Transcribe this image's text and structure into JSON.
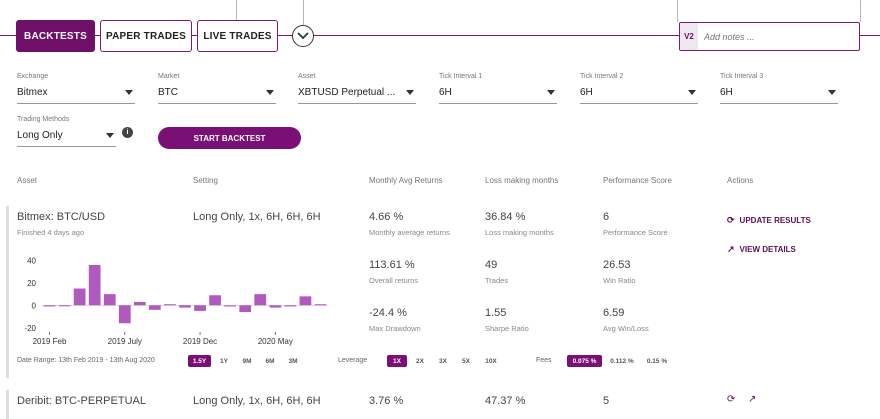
{
  "tabs": [
    {
      "label": "BACKTESTS",
      "active": true
    },
    {
      "label": "PAPER TRADES",
      "active": false
    },
    {
      "label": "LIVE TRADES",
      "active": false
    }
  ],
  "notes": {
    "version": "V2",
    "placeholder": "Add notes ..."
  },
  "form": {
    "exchange": {
      "label": "Exchange",
      "value": "Bitmex"
    },
    "market": {
      "label": "Market",
      "value": "BTC"
    },
    "asset": {
      "label": "Asset",
      "value": "XBTUSD Perpetual ..."
    },
    "tick1": {
      "label": "Tick Interval 1",
      "value": "6H"
    },
    "tick2": {
      "label": "Tick Interval 2",
      "value": "6H"
    },
    "tick3": {
      "label": "Tick Interval 3",
      "value": "6H"
    },
    "trading": {
      "label": "Trading Methods",
      "value": "Long Only"
    },
    "info_icon": "i",
    "start_label": "START BACKTEST"
  },
  "columns": [
    "Asset",
    "Setting",
    "Monthly Avg Returns",
    "Loss making months",
    "Performance Score",
    "Actions"
  ],
  "results": [
    {
      "asset": "Bitmex: BTC/USD",
      "finished": "Finished 4 days ago",
      "setting": "Long Only, 1x, 6H, 6H, 6H",
      "monthly_avg": "4.66 %",
      "monthly_avg_label": "Monthly average returns",
      "loss_months": "36.84 %",
      "loss_months_label": "Loss making months",
      "perf_score": "6",
      "perf_score_label": "Performance Score",
      "overall": "113.61 %",
      "overall_label": "Overall returns",
      "trades": "49",
      "trades_label": "Trades",
      "win_ratio": "26.53",
      "win_ratio_label": "Win Ratio",
      "max_dd": "-24.4 %",
      "max_dd_label": "Max Drawdown",
      "sharpe": "1.55",
      "sharpe_label": "Sharpe Ratio",
      "avg_wl": "6.59",
      "avg_wl_label": "Avg Win/Loss",
      "update_label": "UPDATE RESULTS",
      "details_label": "VIEW DETAILS",
      "date_range": "Date Range: 13th Feb 2019 - 13th Aug 2020",
      "ranges": [
        {
          "label": "1.5Y",
          "on": true
        },
        {
          "label": "1Y",
          "on": false
        },
        {
          "label": "9M",
          "on": false
        },
        {
          "label": "6M",
          "on": false
        },
        {
          "label": "3M",
          "on": false
        }
      ],
      "leverage_label": "Leverage",
      "leverages": [
        {
          "label": "1X",
          "on": true
        },
        {
          "label": "2X",
          "on": false
        },
        {
          "label": "3X",
          "on": false
        },
        {
          "label": "5X",
          "on": false
        },
        {
          "label": "10X",
          "on": false
        }
      ],
      "fees_label": "Fees",
      "fees": [
        {
          "label": "0.075 %",
          "on": true
        },
        {
          "label": "0.112 %",
          "on": false
        },
        {
          "label": "0.15 %",
          "on": false
        }
      ]
    },
    {
      "asset": "Deribit: BTC-PERPETUAL",
      "setting": "Long Only, 1x, 6H, 6H, 6H",
      "monthly_avg": "3.76 %",
      "loss_months": "47.37 %",
      "perf_score": "5"
    }
  ],
  "chart_data": {
    "type": "bar",
    "categories": [
      "2019-02",
      "2019-03",
      "2019-04",
      "2019-05",
      "2019-06",
      "2019-07",
      "2019-08",
      "2019-09",
      "2019-10",
      "2019-11",
      "2019-12",
      "2020-01",
      "2020-02",
      "2020-03",
      "2020-04",
      "2020-05",
      "2020-06",
      "2020-07",
      "2020-08"
    ],
    "values": [
      -1,
      0,
      15,
      36,
      10,
      -16,
      3,
      -4,
      1,
      -2,
      -5,
      9,
      -1,
      -6,
      10,
      -2,
      -1,
      8,
      1
    ],
    "color": "#b05ac0",
    "xtick_labels": [
      "2019 Feb",
      "2019 July",
      "2019 Dec",
      "2020 May"
    ],
    "yticks": [
      40,
      20,
      0,
      -20
    ],
    "ylim": [
      -22,
      44
    ],
    "grid": false
  },
  "colors": {
    "accent": "#6f0f68",
    "bar": "#b05ac0"
  }
}
